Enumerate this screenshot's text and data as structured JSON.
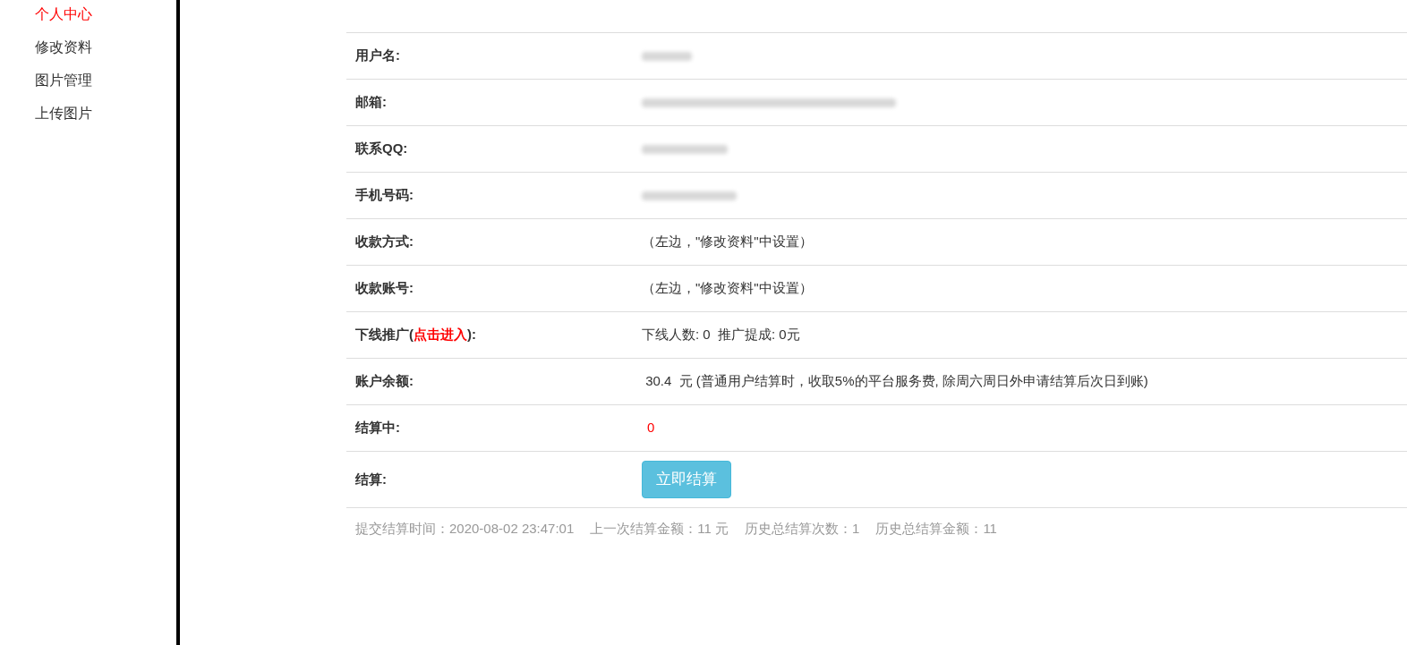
{
  "sidebar": {
    "items": [
      {
        "label": "个人中心",
        "selected": true
      },
      {
        "label": "修改资料",
        "selected": false
      },
      {
        "label": "图片管理",
        "selected": false
      },
      {
        "label": "上传图片",
        "selected": false
      }
    ]
  },
  "info_table": {
    "rows": [
      {
        "kind": "redacted",
        "label": "用户名:"
      },
      {
        "kind": "redacted",
        "label": "邮箱:"
      },
      {
        "kind": "redacted",
        "label": "联系QQ:"
      },
      {
        "kind": "redacted",
        "label": "手机号码:"
      },
      {
        "kind": "text",
        "label": "收款方式:",
        "value": "（左边，\"修改资料\"中设置）"
      },
      {
        "kind": "text",
        "label": "收款账号:",
        "value": "（左边，\"修改资料\"中设置）"
      },
      {
        "kind": "link",
        "label": "下线推广(",
        "link": "点击进入",
        "label_end": "):",
        "value": "下线人数: 0  推广提成: 0元"
      },
      {
        "kind": "text",
        "label": "账户余额:",
        "value": " 30.4  元 (普通用户结算时，收取5%的平台服务费, 除周六周日外申请结算后次日到账)"
      },
      {
        "kind": "alert",
        "label": "结算中:",
        "value": "0"
      },
      {
        "kind": "button",
        "label": "结算:",
        "button": "立即结算"
      }
    ]
  },
  "footer": [
    "提交结算时间：2020-08-02 23:47:01",
    "上一次结算金额：11 元",
    "历史总结算次数：1",
    "历史总结算金额：11"
  ]
}
